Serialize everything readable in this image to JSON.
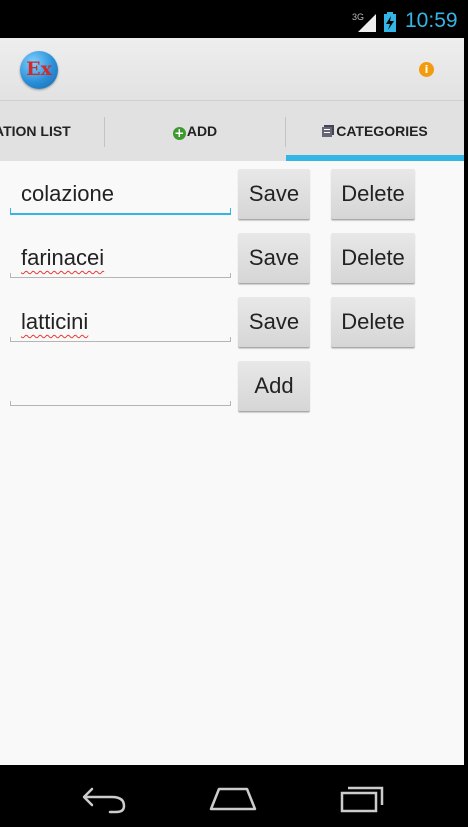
{
  "status_bar": {
    "network": "3G",
    "time": "10:59",
    "icons": [
      "signal-icon",
      "battery-charging-icon"
    ]
  },
  "action_bar": {
    "logo_text": "Ex",
    "menu_icon": "info-icon"
  },
  "tabs": [
    {
      "label": "ATION LIST",
      "selected": false
    },
    {
      "label": "ADD",
      "icon": "plus-circle-icon",
      "selected": false
    },
    {
      "label": "CATEGORIES",
      "icon": "categories-icon",
      "selected": true
    }
  ],
  "categories": [
    {
      "value": "colazione",
      "focused": true,
      "save_label": "Save",
      "delete_label": "Delete"
    },
    {
      "value": "farinacei",
      "focused": false,
      "spell_error": true,
      "save_label": "Save",
      "delete_label": "Delete"
    },
    {
      "value": "latticini",
      "focused": false,
      "spell_error": true,
      "save_label": "Save",
      "delete_label": "Delete"
    }
  ],
  "new_category": {
    "value": "",
    "add_label": "Add"
  },
  "nav_bar": [
    "back-icon",
    "home-icon",
    "recent-apps-icon"
  ],
  "colors": {
    "accent": "#33b5e5",
    "spell_underline": "#e53935",
    "add_icon": "#3d9a2e",
    "info_icon": "#f29b0c"
  }
}
